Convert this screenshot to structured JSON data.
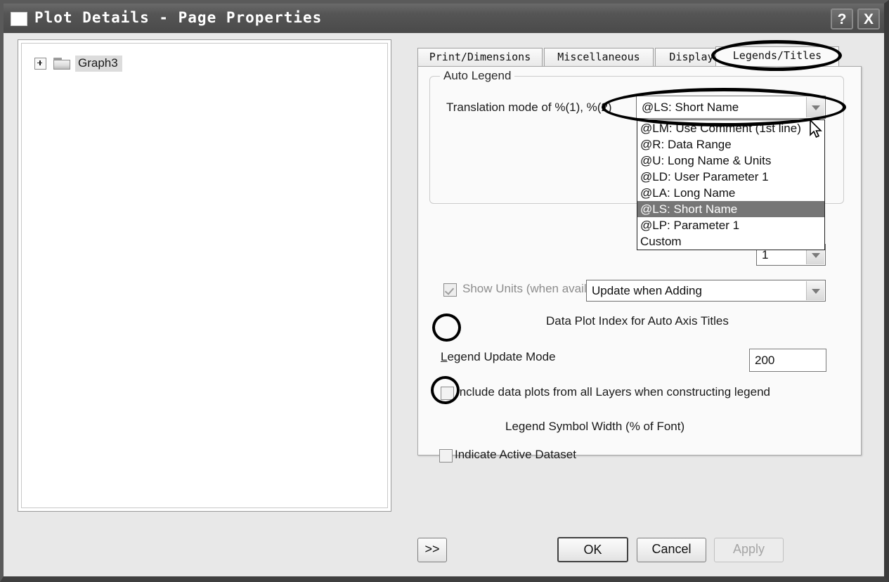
{
  "window": {
    "title": "Plot Details - Page Properties",
    "help_button": "?",
    "close_button": "X",
    "icon": "window-icon"
  },
  "tree": {
    "root_label": "Graph3",
    "expander": "+"
  },
  "tabs": [
    {
      "label": "Print/Dimensions",
      "selected": false
    },
    {
      "label": "Miscellaneous",
      "selected": false
    },
    {
      "label": "Display",
      "selected": false
    },
    {
      "label": "Legends/Titles",
      "selected": true
    }
  ],
  "auto_legend": {
    "group_title": "Auto Legend",
    "translation_mode_label": "Translation mode of %(1), %(2)",
    "translation_mode_value": "@LS: Short Name",
    "dropdown_open": true,
    "dropdown_options": [
      {
        "label": "@LM: Use Comment (1st line)",
        "selected": false
      },
      {
        "label": "@R: Data Range",
        "selected": false
      },
      {
        "label": "@U: Long Name & Units",
        "selected": false
      },
      {
        "label": "@LD: User Parameter 1",
        "selected": false
      },
      {
        "label": "@LA: Long Name",
        "selected": false
      },
      {
        "label": "@LS: Short Name",
        "selected": true
      },
      {
        "label": "@LP: Parameter 1",
        "selected": false
      },
      {
        "label": "Custom",
        "selected": false
      }
    ]
  },
  "options": {
    "show_units_label": "Show Units (when available) for",
    "show_units_checked": true,
    "data_plot_index_label": "Data Plot Index for Auto Axis Titles",
    "data_plot_index_value": "1",
    "legend_update_mode_label": "Legend Update Mode",
    "legend_update_mode_value": "Update when Adding",
    "include_all_layers_label": "Include data plots from all Layers when constructing legend",
    "include_all_layers_checked": false,
    "legend_symbol_width_label": "Legend Symbol Width (% of Font)",
    "legend_symbol_width_value": "200",
    "indicate_active_dataset_label": "Indicate Active Dataset",
    "indicate_active_dataset_checked": false
  },
  "footer": {
    "expand_button": ">>",
    "ok_button": "OK",
    "cancel_button": "Cancel",
    "apply_button": "Apply",
    "apply_disabled": true
  },
  "colors": {
    "dialog_bg": "#e8e8e8",
    "panel_bg": "#fafafa",
    "titlebar": "#555555",
    "highlight": "#767676",
    "annotation": "#000000"
  }
}
